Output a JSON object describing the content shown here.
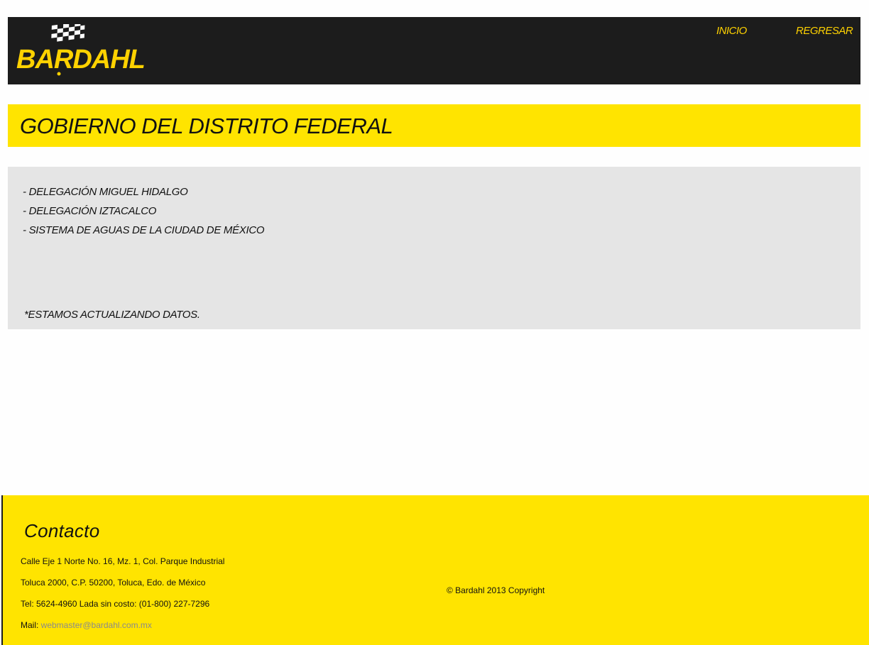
{
  "header": {
    "logo_text": "BARDAHL",
    "nav": {
      "inicio": "INICIO",
      "regresar": "REGRESAR"
    }
  },
  "page": {
    "title": "GOBIERNO DEL DISTRITO FEDERAL"
  },
  "content": {
    "items": [
      "- DELEGACIÓN MIGUEL HIDALGO",
      "- DELEGACIÓN IZTACALCO",
      "- SISTEMA DE AGUAS DE LA CIUDAD DE MÉXICO"
    ],
    "note": "*ESTAMOS ACTUALIZANDO DATOS."
  },
  "footer": {
    "heading": "Contacto",
    "address_line1": "Calle Eje 1 Norte No. 16, Mz. 1, Col. Parque Industrial",
    "address_line2": "Toluca 2000, C.P. 50200, Toluca, Edo. de México",
    "phone_line": "Tel: 5624-4960  Lada sin costo: (01-800) 227-7296",
    "mail_label": "Mail: ",
    "mail_address": "webmaster@bardahl.com.mx",
    "copyright": "© Bardahl 2013 Copyright"
  },
  "colors": {
    "brand_yellow": "#ffe400",
    "link_yellow": "#ffd200",
    "header_bg": "#1c1c1c",
    "content_bg": "#e5e5e5"
  }
}
